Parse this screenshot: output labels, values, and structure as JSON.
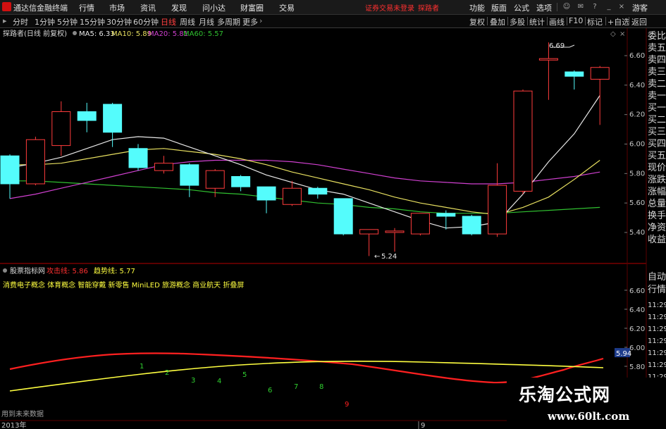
{
  "titlebar": {
    "app_name": "通达信金融终端",
    "menus": [
      "行情",
      "市场",
      "资讯",
      "发现",
      "问小达",
      "财富圈",
      "交易"
    ],
    "warning": "证券交易未登录",
    "warning2": "探路者",
    "right_menus": [
      "功能",
      "版面",
      "公式",
      "选项"
    ],
    "guest": "游客"
  },
  "toolbar": {
    "periods": [
      "分时",
      "1分钟",
      "5分钟",
      "15分钟",
      "30分钟",
      "60分钟",
      "日线",
      "周线",
      "月线",
      "多周期",
      "更多"
    ],
    "active_period": "日线",
    "right_buttons": [
      "复权",
      "叠加",
      "多股",
      "统计",
      "画线",
      "F10",
      "标记",
      "+自选",
      "返回"
    ]
  },
  "main_chart": {
    "legend": {
      "stock": "探路者(日线 前复权)",
      "ma5_label": "MA5: 6.33",
      "ma10_label": "MA10: 5.89",
      "ma20_label": "MA20: 5.81",
      "ma60_label": "MA60: 5.57"
    },
    "annotation_high": "6.69",
    "annotation_low": "5.24"
  },
  "sub_chart": {
    "title": "股票指标网",
    "label1": "攻击线: 5.86",
    "label2": "趋势线: 5.77",
    "concepts": "消费电子概念 体育概念 智能穿戴 新零售 MiniLED 旅游概念 商业航天 折叠屏",
    "point_labels": [
      "1",
      "2",
      "3",
      "4",
      "5",
      "6",
      "7",
      "8",
      "9"
    ],
    "footer_note": "用到未来数据"
  },
  "axis": {
    "price_ticks": [
      "6.60",
      "6.40",
      "6.20",
      "6.00",
      "5.80",
      "5.60",
      "5.40"
    ],
    "sub_ticks": [
      "6.60",
      "6.40",
      "6.20",
      "6.00",
      "5.94",
      "5.80"
    ],
    "sub_current": "5.94",
    "time_ticks": [
      "11:29",
      "11:29",
      "11:29",
      "11:29",
      "11:29",
      "11:29",
      "11:29",
      "11:29"
    ],
    "year_label": "2013年",
    "month_label": "9"
  },
  "right_panel": {
    "items": [
      "委比",
      "卖五",
      "卖四",
      "卖三",
      "卖二",
      "卖一",
      "买一",
      "买二",
      "买三",
      "买四",
      "买五",
      "现价",
      "涨跌",
      "涨幅",
      "总量",
      "换手",
      "净资",
      "收益"
    ],
    "bottom_items": [
      "自动",
      "行情"
    ]
  },
  "watermark": {
    "title": "乐淘公式网",
    "url": "www.60lt.com"
  },
  "colors": {
    "up": "#ff3c3c",
    "down": "#54fcfc",
    "ma5": "#e8e8e8",
    "ma10": "#e8e060",
    "ma20": "#d040d0",
    "ma60": "#30c030",
    "attack": "#ff2020",
    "trend": "#ffff40"
  },
  "chart_data": {
    "type": "candlestick",
    "ylim": [
      5.3,
      6.72
    ],
    "candles": [
      {
        "o": 5.92,
        "c": 5.73,
        "h": 5.93,
        "l": 5.63
      },
      {
        "o": 5.73,
        "c": 6.03,
        "h": 6.05,
        "l": 5.72
      },
      {
        "o": 5.99,
        "c": 6.22,
        "h": 6.29,
        "l": 5.92
      },
      {
        "o": 6.22,
        "c": 6.16,
        "h": 6.28,
        "l": 6.08
      },
      {
        "o": 6.27,
        "c": 6.08,
        "h": 6.28,
        "l": 5.98
      },
      {
        "o": 5.97,
        "c": 5.84,
        "h": 6.0,
        "l": 5.82
      },
      {
        "o": 5.82,
        "c": 5.87,
        "h": 5.92,
        "l": 5.8
      },
      {
        "o": 5.86,
        "c": 5.72,
        "h": 5.87,
        "l": 5.64
      },
      {
        "o": 5.7,
        "c": 5.82,
        "h": 5.83,
        "l": 5.64
      },
      {
        "o": 5.78,
        "c": 5.71,
        "h": 5.79,
        "l": 5.68
      },
      {
        "o": 5.71,
        "c": 5.62,
        "h": 5.71,
        "l": 5.53
      },
      {
        "o": 5.59,
        "c": 5.7,
        "h": 5.75,
        "l": 5.58
      },
      {
        "o": 5.7,
        "c": 5.66,
        "h": 5.71,
        "l": 5.63
      },
      {
        "o": 5.63,
        "c": 5.39,
        "h": 5.63,
        "l": 5.38
      },
      {
        "o": 5.39,
        "c": 5.42,
        "h": 5.42,
        "l": 5.24
      },
      {
        "o": 5.4,
        "c": 5.41,
        "h": 5.43,
        "l": 5.27
      },
      {
        "o": 5.39,
        "c": 5.53,
        "h": 5.53,
        "l": 5.38
      },
      {
        "o": 5.53,
        "c": 5.51,
        "h": 5.55,
        "l": 5.42
      },
      {
        "o": 5.51,
        "c": 5.39,
        "h": 5.52,
        "l": 5.38
      },
      {
        "o": 5.39,
        "c": 5.72,
        "h": 5.87,
        "l": 5.37
      },
      {
        "o": 5.68,
        "c": 6.36,
        "h": 6.37,
        "l": 5.66
      },
      {
        "o": 6.57,
        "c": 6.58,
        "h": 6.69,
        "l": 6.3
      },
      {
        "o": 6.49,
        "c": 6.46,
        "h": 6.5,
        "l": 6.37
      },
      {
        "o": 6.44,
        "c": 6.52,
        "h": 6.53,
        "l": 6.13
      }
    ],
    "ma5": [
      5.84,
      5.87,
      5.91,
      5.97,
      6.03,
      6.05,
      6.04,
      5.98,
      5.92,
      5.86,
      5.79,
      5.74,
      5.69,
      5.66,
      5.6,
      5.54,
      5.48,
      5.43,
      5.44,
      5.47,
      5.66,
      5.88,
      6.07,
      6.33
    ],
    "ma10": [
      5.86,
      5.86,
      5.87,
      5.9,
      5.93,
      5.96,
      5.97,
      5.95,
      5.93,
      5.9,
      5.86,
      5.81,
      5.77,
      5.73,
      5.69,
      5.64,
      5.6,
      5.57,
      5.54,
      5.52,
      5.57,
      5.64,
      5.76,
      5.89
    ],
    "ma20": [
      5.63,
      5.66,
      5.7,
      5.74,
      5.78,
      5.82,
      5.86,
      5.88,
      5.89,
      5.89,
      5.89,
      5.88,
      5.86,
      5.83,
      5.8,
      5.77,
      5.75,
      5.74,
      5.73,
      5.73,
      5.74,
      5.76,
      5.78,
      5.81
    ],
    "ma60": [
      5.75,
      5.75,
      5.74,
      5.73,
      5.72,
      5.71,
      5.7,
      5.69,
      5.67,
      5.66,
      5.64,
      5.62,
      5.6,
      5.59,
      5.57,
      5.56,
      5.54,
      5.53,
      5.53,
      5.53,
      5.54,
      5.55,
      5.56,
      5.57
    ]
  }
}
